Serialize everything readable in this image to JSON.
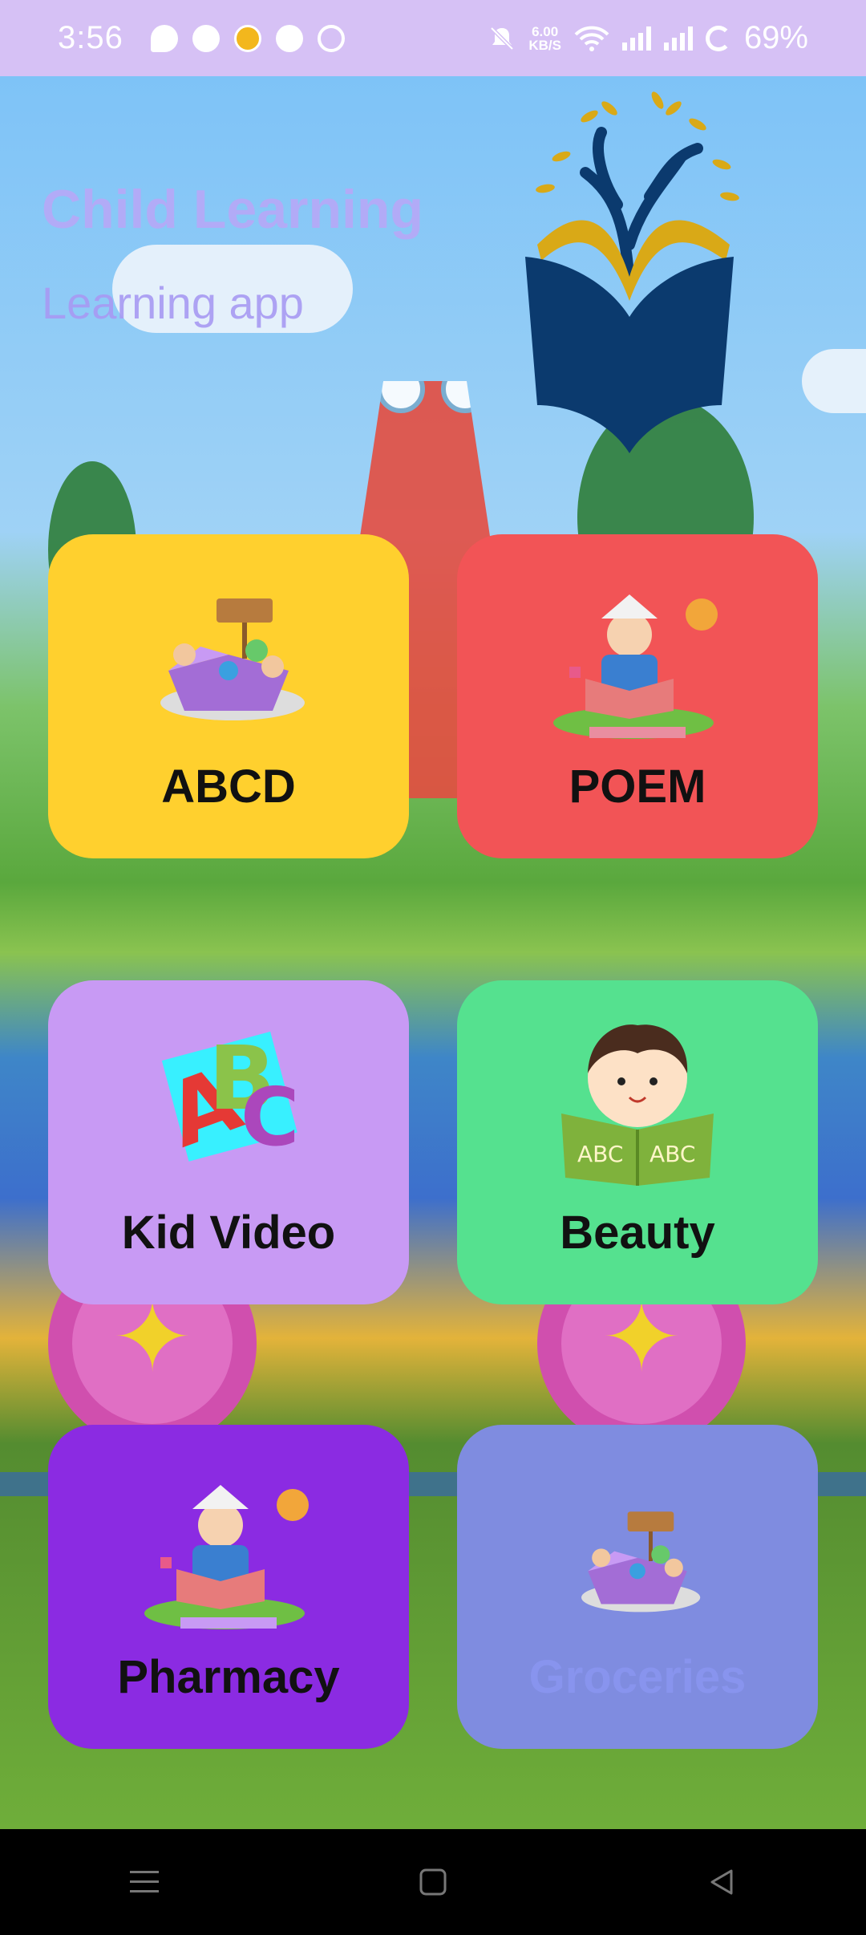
{
  "status_bar": {
    "time": "3:56",
    "net_speed_value": "6.00",
    "net_speed_unit": "KB/S",
    "battery": "69%",
    "notification_icons": [
      "chat-icon",
      "messenger-icon",
      "media-icon",
      "facebook-icon",
      "imo-icon"
    ],
    "system_icons": [
      "mute-icon",
      "wifi-icon",
      "signal-icon",
      "signal-icon",
      "battery-icon"
    ]
  },
  "header": {
    "title": "Child Learning",
    "subtitle": "Learning app",
    "logo_icon": "book-tree-logo-icon"
  },
  "categories": [
    {
      "label": "ABCD",
      "color": "#ffd02e",
      "icon": "kids-abc-box-icon"
    },
    {
      "label": "POEM",
      "color": "#f25456",
      "icon": "child-reading-icon"
    },
    {
      "label": "Kid Video",
      "color": "#c89af4",
      "icon": "abc-letters-icon"
    },
    {
      "label": "Beauty",
      "color": "#55e18f",
      "icon": "boy-reading-abc-book-icon"
    },
    {
      "label": "Pharmacy",
      "color": "#8b2be2",
      "icon": "child-reading-icon"
    },
    {
      "label": "Groceries",
      "color": "#7f8ce0",
      "icon": "kids-abc-box-icon"
    }
  ],
  "nav_bar": {
    "items": [
      "menu-icon",
      "home-icon",
      "back-icon"
    ]
  },
  "colors": {
    "status_bar": "#d6c1f5",
    "title_text": "#b7a8f7",
    "logo_navy": "#0b3a6e",
    "logo_gold": "#d9a917"
  }
}
